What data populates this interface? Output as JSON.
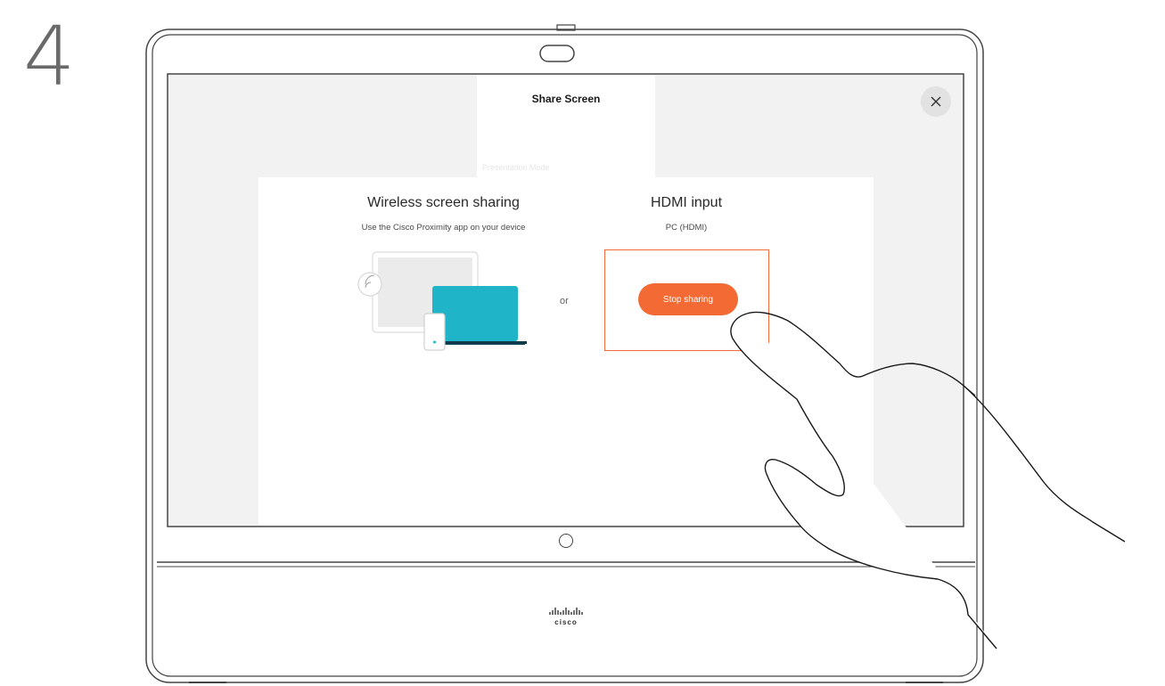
{
  "step": {
    "number": "4"
  },
  "screen": {
    "title": "Share Screen",
    "tab_ghost_label": "Presentation Mode",
    "close_icon": "close-icon",
    "wireless": {
      "title": "Wireless screen sharing",
      "subtitle": "Use the Cisco Proximity app on your device",
      "illustration_icon": "wireless-devices-illustration"
    },
    "separator": "or",
    "hdmi": {
      "title": "HDMI input",
      "subtitle": "PC (HDMI)",
      "stop_button_label": "Stop sharing"
    }
  },
  "device": {
    "brand_mark": "cisco",
    "home_button_icon": "home-button-icon",
    "camera_icon": "camera-icon"
  },
  "colors": {
    "accent": "#f36a34",
    "highlight_border": "#f26b3a",
    "screen_bg": "#f2f2f2",
    "laptop_teal": "#1fb4c8"
  }
}
